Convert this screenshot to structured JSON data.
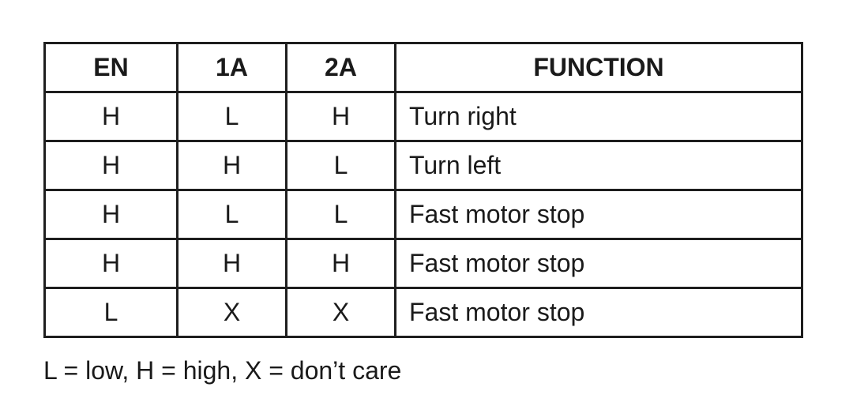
{
  "table": {
    "headers": [
      "EN",
      "1A",
      "2A",
      "FUNCTION"
    ],
    "rows": [
      [
        "H",
        "L",
        "H",
        "Turn right"
      ],
      [
        "H",
        "H",
        "L",
        "Turn left"
      ],
      [
        "H",
        "L",
        "L",
        "Fast motor stop"
      ],
      [
        "H",
        "H",
        "H",
        "Fast motor stop"
      ],
      [
        "L",
        "X",
        "X",
        "Fast motor stop"
      ]
    ]
  },
  "legend": "L = low, H = high, X = don’t care"
}
